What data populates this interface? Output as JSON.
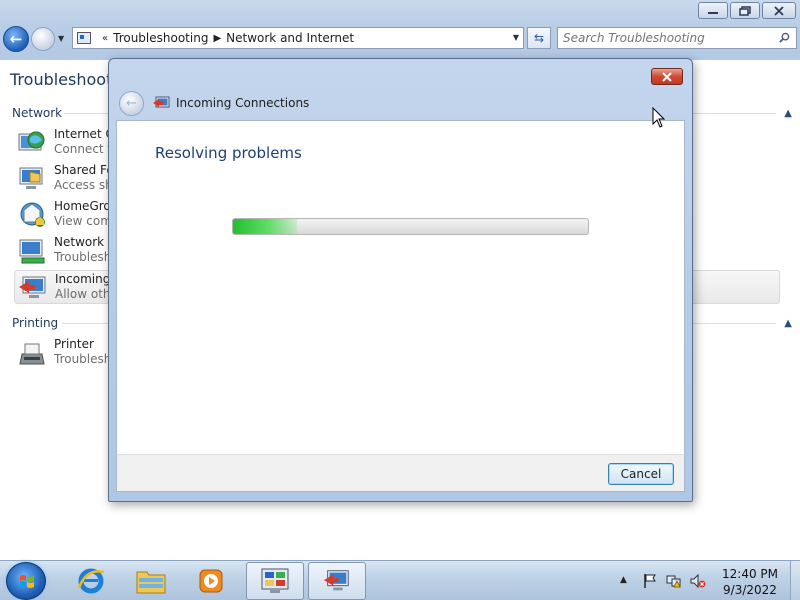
{
  "window": {
    "caption_buttons": [
      {
        "name": "minimize",
        "glyph": "▭"
      },
      {
        "name": "maximize",
        "glyph": "⧉"
      },
      {
        "name": "close",
        "glyph": "✕"
      }
    ]
  },
  "toolbar": {
    "breadcrumb_overflow": "«",
    "breadcrumbs": [
      "Troubleshooting",
      "Network and Internet"
    ],
    "search_placeholder": "Search Troubleshooting"
  },
  "page": {
    "title": "Troubleshoot p",
    "sections": [
      {
        "heading": "Network",
        "items": [
          {
            "title": "Internet Co",
            "desc": "Connect to",
            "icon": "internet-connections-icon"
          },
          {
            "title": "Shared Fol",
            "desc": "Access sha",
            "icon": "shared-folders-icon"
          },
          {
            "title": "HomeGrou",
            "desc": "View comp",
            "icon": "homegroup-icon"
          },
          {
            "title": "Network A",
            "desc": "Troublesh",
            "icon": "network-adapter-icon"
          },
          {
            "title": "Incoming",
            "desc": "Allow othe",
            "icon": "incoming-connections-icon",
            "selected": true
          }
        ]
      },
      {
        "heading": "Printing",
        "items": [
          {
            "title": "Printer",
            "desc": "Troublesh",
            "icon": "printer-icon"
          }
        ]
      }
    ]
  },
  "dialog": {
    "title": "Incoming Connections",
    "heading": "Resolving problems",
    "progress": 0.18,
    "cancel_label": "Cancel"
  },
  "taskbar": {
    "pinned": [
      "internet-explorer-icon",
      "windows-explorer-icon",
      "media-player-icon",
      "control-panel-icon",
      "troubleshooter-icon"
    ],
    "clock_time": "12:40 PM",
    "clock_date": "9/3/2022"
  },
  "colors": {
    "accent": "#1e395b",
    "progress_green": "#22c02f",
    "close_red": "#c23a22"
  }
}
